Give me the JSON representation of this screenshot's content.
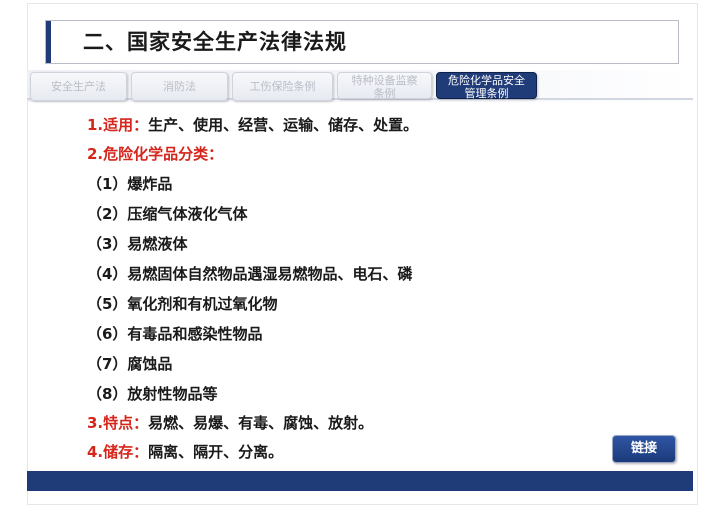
{
  "title": "二、国家安全生产法律法规",
  "tabs": [
    {
      "label": "安全生产法"
    },
    {
      "label": "消防法"
    },
    {
      "label": "工伤保险条例"
    },
    {
      "label_line1": "特种设备监察",
      "label_line2": "条例"
    },
    {
      "label_line1": "危险化学品安全",
      "label_line2": "管理条例"
    }
  ],
  "content": {
    "item1": {
      "label": "1.适用：",
      "text": "生产、使用、经营、运输、储存、处置。"
    },
    "item2": {
      "label": "2.危险化学品分类："
    },
    "categories": [
      "（1）爆炸品",
      "（2）压缩气体液化气体",
      "（3）易燃液体",
      "（4）易燃固体自然物品遇湿易燃物品、电石、磷",
      "（5）氧化剂和有机过氧化物",
      "（6）有毒品和感染性物品",
      "（7）腐蚀品",
      "（8）放射性物品等"
    ],
    "item3": {
      "label": "3.特点：",
      "text": "易燃、易爆、有毒、腐蚀、放射。"
    },
    "item4": {
      "label": "4.储存：",
      "text": "隔离、隔开、分离。"
    }
  },
  "link_button": "链接",
  "colors": {
    "accent": "#1f3b78",
    "red": "#d6261c"
  }
}
